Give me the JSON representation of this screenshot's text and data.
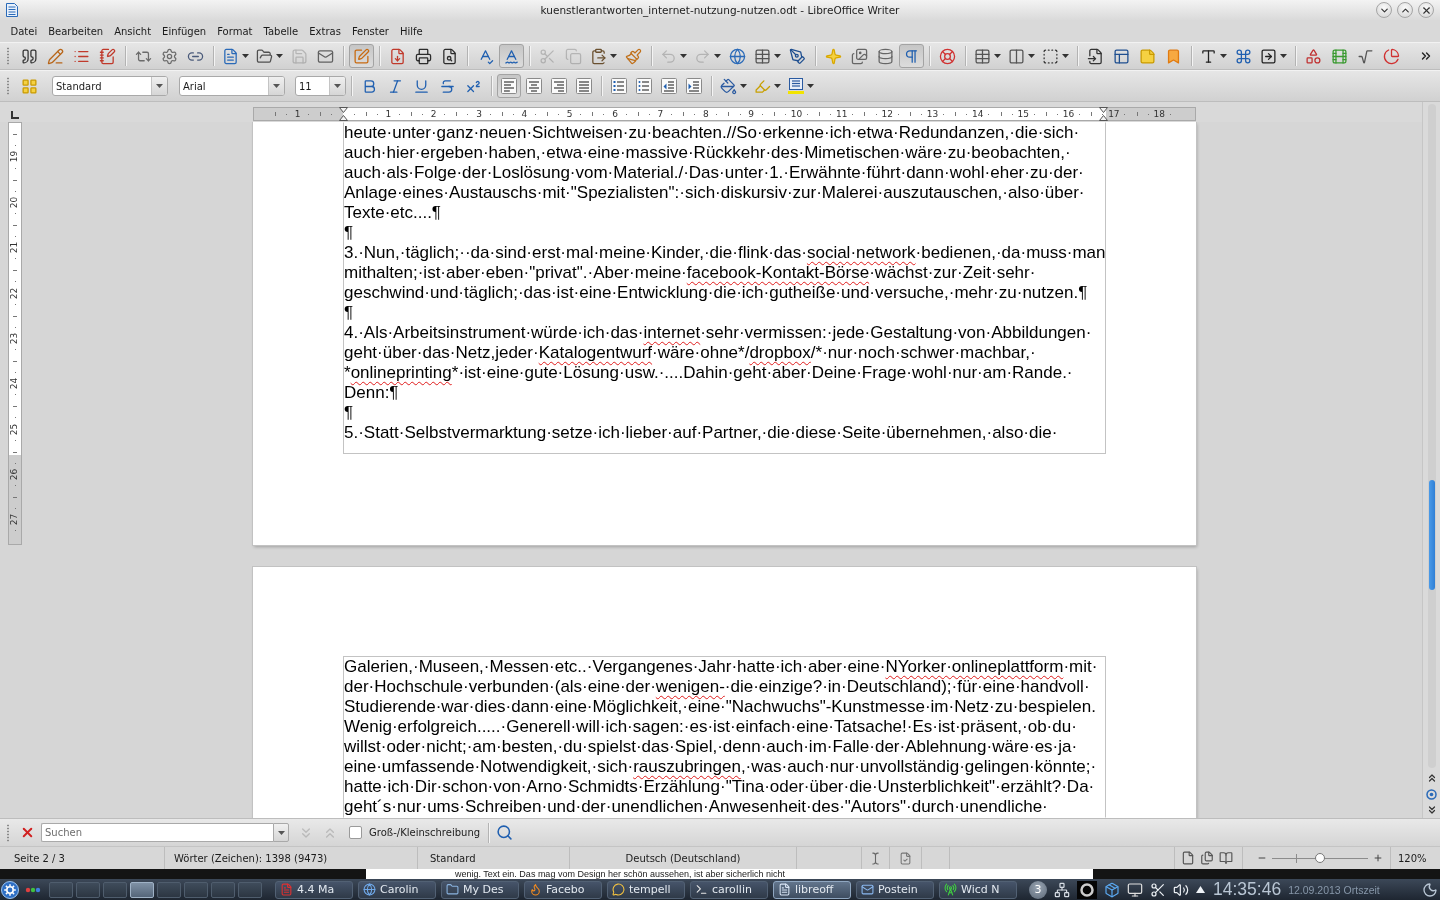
{
  "window": {
    "title": "kuenstlerantworten_internet-nutzung-nutzen.odt - LibreOffice Writer"
  },
  "menu": [
    "Datei",
    "Bearbeiten",
    "Ansicht",
    "Einfügen",
    "Format",
    "Tabelle",
    "Extras",
    "Fenster",
    "Hilfe"
  ],
  "standard_toolbar": {
    "groups": [
      [
        {
          "pressed": false,
          "disabled": false,
          "dropdown": false
        },
        {
          "pressed": false,
          "disabled": false,
          "dropdown": false
        },
        {
          "pressed": false,
          "disabled": false,
          "dropdown": false
        },
        {
          "pressed": false,
          "disabled": false,
          "dropdown": false
        }
      ],
      [
        {
          "pressed": false,
          "disabled": false,
          "dropdown": false
        },
        {
          "pressed": false,
          "disabled": false,
          "dropdown": false
        },
        {
          "pressed": false,
          "disabled": false,
          "dropdown": false
        }
      ],
      [
        {
          "pressed": false,
          "disabled": false,
          "dropdown": true
        },
        {
          "pressed": false,
          "disabled": false,
          "dropdown": true
        },
        {
          "pressed": false,
          "disabled": true,
          "dropdown": false
        },
        {
          "pressed": false,
          "disabled": false,
          "dropdown": false
        }
      ],
      [
        {
          "pressed": true,
          "disabled": false,
          "dropdown": false
        }
      ],
      [
        {
          "pressed": false,
          "disabled": false,
          "dropdown": false
        },
        {
          "pressed": false,
          "disabled": false,
          "dropdown": false
        },
        {
          "pressed": false,
          "disabled": false,
          "dropdown": false
        }
      ],
      [
        {
          "pressed": false,
          "disabled": false,
          "dropdown": false
        },
        {
          "pressed": true,
          "disabled": false,
          "dropdown": false
        }
      ],
      [
        {
          "pressed": false,
          "disabled": true,
          "dropdown": false
        },
        {
          "pressed": false,
          "disabled": true,
          "dropdown": false
        },
        {
          "pressed": false,
          "disabled": false,
          "dropdown": true
        },
        {
          "pressed": false,
          "disabled": false,
          "dropdown": false
        }
      ],
      [
        {
          "pressed": false,
          "disabled": true,
          "dropdown": true
        },
        {
          "pressed": false,
          "disabled": true,
          "dropdown": true
        },
        {
          "pressed": false,
          "disabled": false,
          "dropdown": false
        },
        {
          "pressed": false,
          "disabled": false,
          "dropdown": true
        },
        {
          "pressed": false,
          "disabled": false,
          "dropdown": false
        }
      ],
      [
        {
          "pressed": false,
          "disabled": false,
          "dropdown": false
        },
        {
          "pressed": false,
          "disabled": false,
          "dropdown": false
        },
        {
          "pressed": false,
          "disabled": false,
          "dropdown": false
        },
        {
          "pressed": true,
          "disabled": false,
          "dropdown": false
        }
      ],
      [
        {
          "pressed": false,
          "disabled": false,
          "dropdown": false
        }
      ],
      [
        {
          "pressed": false,
          "disabled": false,
          "dropdown": true
        },
        {
          "pressed": false,
          "disabled": false,
          "dropdown": true
        },
        {
          "pressed": false,
          "disabled": false,
          "dropdown": true
        }
      ],
      [
        {
          "pressed": false,
          "disabled": false,
          "dropdown": false
        },
        {
          "pressed": false,
          "disabled": false,
          "dropdown": false
        },
        {
          "pressed": false,
          "disabled": false,
          "dropdown": false
        },
        {
          "pressed": false,
          "disabled": false,
          "dropdown": false
        }
      ],
      [
        {
          "pressed": false,
          "disabled": false,
          "dropdown": true
        },
        {
          "pressed": false,
          "disabled": false,
          "dropdown": false
        },
        {
          "pressed": false,
          "disabled": false,
          "dropdown": true
        }
      ],
      [
        {
          "pressed": false,
          "disabled": false,
          "dropdown": false
        },
        {
          "pressed": false,
          "disabled": false,
          "dropdown": false
        },
        {
          "pressed": false,
          "disabled": false,
          "dropdown": false
        },
        {
          "pressed": false,
          "disabled": false,
          "dropdown": false
        }
      ]
    ]
  },
  "formatting_toolbar": {
    "paragraph_style": "Standard",
    "font_name": "Arial",
    "font_size": "11",
    "groups": [
      [
        {
          "pressed": false,
          "disabled": false,
          "dropdown": false
        }
      ],
      [
        {
          "pressed": false,
          "disabled": false,
          "dropdown": false
        },
        {
          "pressed": false,
          "disabled": false,
          "dropdown": false
        },
        {
          "pressed": false,
          "disabled": false,
          "dropdown": false
        },
        {
          "pressed": false,
          "disabled": false,
          "dropdown": false
        },
        {
          "pressed": false,
          "disabled": false,
          "dropdown": false
        }
      ],
      [
        {
          "pressed": true,
          "disabled": false,
          "dropdown": false
        },
        {
          "pressed": false,
          "disabled": false,
          "dropdown": false
        },
        {
          "pressed": false,
          "disabled": false,
          "dropdown": false
        },
        {
          "pressed": false,
          "disabled": false,
          "dropdown": false
        }
      ],
      [
        {
          "pressed": false,
          "disabled": false,
          "dropdown": false
        },
        {
          "pressed": false,
          "disabled": false,
          "dropdown": false
        },
        {
          "pressed": false,
          "disabled": false,
          "dropdown": false
        },
        {
          "pressed": false,
          "disabled": false,
          "dropdown": false
        }
      ],
      [
        {
          "pressed": false,
          "disabled": false,
          "dropdown": true
        },
        {
          "pressed": false,
          "disabled": false,
          "dropdown": true
        },
        {
          "pressed": false,
          "disabled": false,
          "dropdown": true
        }
      ]
    ]
  },
  "horizontal_ruler": {
    "labels": [
      "1",
      "1",
      "2",
      "3",
      "4",
      "5",
      "6",
      "7",
      "8",
      "9",
      "10",
      "11",
      "12",
      "13",
      "14",
      "15",
      "16",
      "17",
      "18"
    ]
  },
  "vertical_ruler": {
    "labels": [
      "19",
      "20",
      "21",
      "22",
      "23",
      "24",
      "25",
      "26",
      "27"
    ]
  },
  "pages": [
    {
      "paragraphs": [
        {
          "lines": [
            [
              {
                "text": "heute·unter·ganz·neuen·Sichtweisen·zu·beachten.//So·erkenne·ich·etwa·Redundanzen,·die·sich·",
                "misspelled": false
              }
            ],
            [
              {
                "text": "auch·hier·ergeben·haben,·etwa·eine·massive·Rückkehr·des·Mimetischen·wäre·zu·beobachten,·",
                "misspelled": false
              }
            ],
            [
              {
                "text": "auch·als·Folge·der·Loslösung·vom·Material./·Das·unter·1.·Erwähnte·führt·dann·wohl·eher·zu·der·",
                "misspelled": false
              }
            ],
            [
              {
                "text": "Anlage·eines·Austauschs·mit·\"Spezialisten\":·sich·diskursiv·zur·Malerei·auszutauschen,·also·über·",
                "misspelled": false
              }
            ],
            [
              {
                "text": "Texte·etc....¶",
                "misspelled": false
              }
            ]
          ]
        },
        {
          "lines": [
            [
              {
                "text": "¶",
                "misspelled": false
              }
            ]
          ]
        },
        {
          "lines": [
            [
              {
                "text": "3.·Nun,·täglich;··da·sind·erst·mal·meine·Kinder,·die·flink·das·",
                "misspelled": false
              },
              {
                "text": "social·network",
                "misspelled": true
              },
              {
                "text": "·bedienen,·da·muss·man",
                "misspelled": false
              }
            ],
            [
              {
                "text": "mithalten;·ist·aber·eben·\"privat\".·Aber·meine·",
                "misspelled": false
              },
              {
                "text": "facebook-Kontakt-Börse",
                "misspelled": true
              },
              {
                "text": "·wächst·zur·Zeit·sehr·",
                "misspelled": false
              }
            ],
            [
              {
                "text": "geschwind·und·täglich;·das·ist·eine·Entwicklung·die·ich·gutheiße·und·versuche,·mehr·zu·nutzen.¶",
                "misspelled": false
              }
            ]
          ]
        },
        {
          "lines": [
            [
              {
                "text": "¶",
                "misspelled": false
              }
            ]
          ]
        },
        {
          "lines": [
            [
              {
                "text": "4.·Als·Arbeitsinstrument·würde·ich·das·",
                "misspelled": false
              },
              {
                "text": "internet",
                "misspelled": true
              },
              {
                "text": "·sehr·vermissen:·jede·Gestaltung·von·Abbildungen·",
                "misspelled": false
              }
            ],
            [
              {
                "text": "geht·über·das·Netz,jeder·",
                "misspelled": false
              },
              {
                "text": "Katalogentwurf",
                "misspelled": true
              },
              {
                "text": "·wäre·ohne*/",
                "misspelled": false
              },
              {
                "text": "dropbox",
                "misspelled": true
              },
              {
                "text": "/*·nur·noch·schwer·machbar,·",
                "misspelled": false
              }
            ],
            [
              {
                "text": "*",
                "misspelled": false
              },
              {
                "text": "onlineprinting",
                "misspelled": true
              },
              {
                "text": "*·ist·eine·gute·Lösung·usw.·....Dahin·geht·aber·Deine·Frage·wohl·nur·am·Rande.·",
                "misspelled": false
              }
            ],
            [
              {
                "text": "Denn:¶",
                "misspelled": false
              }
            ]
          ]
        },
        {
          "lines": [
            [
              {
                "text": "¶",
                "misspelled": false
              }
            ]
          ]
        },
        {
          "lines": [
            [
              {
                "text": "5.·Statt·Selbstvermarktung·setze·ich·lieber·auf·Partner,·die·diese·Seite·übernehmen,·also·die·",
                "misspelled": false
              }
            ]
          ]
        }
      ]
    },
    {
      "paragraphs": [
        {
          "lines": [
            [
              {
                "text": "Galerien,·Museen,·Messen·etc..·Vergangenes·Jahr·hatte·ich·aber·eine·",
                "misspelled": false
              },
              {
                "text": "NYorker·onlineplattform",
                "misspelled": true
              },
              {
                "text": "·mit·",
                "misspelled": false
              }
            ],
            [
              {
                "text": "der·Hochschule·verbunden·(als·eine·der·",
                "misspelled": false
              },
              {
                "text": "wenigen-",
                "misspelled": true
              },
              {
                "text": "·die·einzige?·in·Deutschland);·für·eine·handvoll·",
                "misspelled": false
              }
            ],
            [
              {
                "text": "Studierende·war·dies·dann·eine·Möglichkeit,·eine·\"Nachwuchs\"-Kunstmesse·im·Netz·zu·bespielen.",
                "misspelled": false
              }
            ],
            [
              {
                "text": "Wenig·erfolgreich.....·Generell·will·ich·sagen:·es·ist·einfach·eine·Tatsache!·Es·ist·präsent,·ob·du·",
                "misspelled": false
              }
            ],
            [
              {
                "text": "willst·oder·nicht;·am·besten,·du·spielst·das·Spiel,·denn·auch·im·Falle·der·Ablehnung·wäre·es·ja·",
                "misspelled": false
              }
            ],
            [
              {
                "text": "eine·umfassende·Notwendigkeit,·sich·",
                "misspelled": false
              },
              {
                "text": "rauszubringen",
                "misspelled": true
              },
              {
                "text": ",·was·auch·nur·unvollständig·gelingen·könnte;·",
                "misspelled": false
              }
            ],
            [
              {
                "text": "hatte·ich·Dir·schon·von·Arno·Schmidts·Erzählung·\"Tina·oder·über·die·Unsterblichkeit\"·erzählt?·Da·",
                "misspelled": false
              }
            ],
            [
              {
                "text": "geht´s·nur·ums·Schreiben·und·der·unendlichen·Anwesenheit·des·\"Autors\"·durch·unendliche·",
                "misspelled": false
              }
            ]
          ]
        }
      ]
    }
  ],
  "find_toolbar": {
    "placeholder": "Suchen",
    "navigation": [
      {
        "disabled": true
      },
      {
        "disabled": true
      }
    ],
    "match_case": {
      "label": "Groß-/Kleinschreibung",
      "checked": false
    }
  },
  "status_bar": {
    "page": "Seite 2 / 3",
    "word_count": "Wörter (Zeichen): 1398 (9473)",
    "page_style": "Standard",
    "language": "Deutsch (Deutschland)",
    "zoom_slider": {
      "level": 0.5
    },
    "zoom": "120%"
  },
  "background_window": {
    "text": "wenig. Text ein. Das mag vom Design her schön aussehen, ist aber sicherlich nicht"
  },
  "taskbar": {
    "desktops": [
      {
        "selected": false
      },
      {
        "selected": false
      },
      {
        "selected": false
      },
      {
        "selected": true
      },
      {
        "selected": false
      },
      {
        "selected": false
      },
      {
        "selected": false
      },
      {
        "selected": false
      }
    ],
    "tasks": [
      {
        "label": "4.4 Ma",
        "selected": false
      },
      {
        "label": "Carolin",
        "selected": false
      },
      {
        "label": "My Des",
        "selected": false
      },
      {
        "label": "Facebo",
        "selected": false
      },
      {
        "label": "tempell",
        "selected": false
      },
      {
        "label": "carollin",
        "selected": false
      },
      {
        "label": "libreoff",
        "selected": true
      },
      {
        "label": "Postein",
        "selected": false
      },
      {
        "label": "Wicd N",
        "selected": false
      }
    ],
    "notification_count": "3",
    "clock": "14:35:46",
    "date": "12.09.2013 Ortszeit"
  }
}
